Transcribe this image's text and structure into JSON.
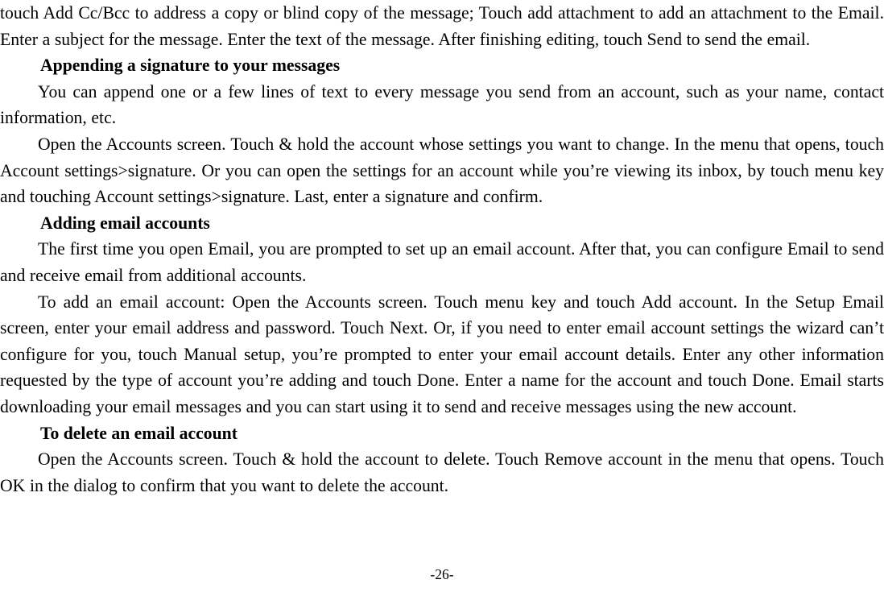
{
  "document": {
    "page_number_label": "-26-",
    "blocks": [
      {
        "type": "paragraph",
        "continued": true,
        "text": "touch Add Cc/Bcc to address a copy or blind copy of the message; Touch add attachment to add an attachment to the Email. Enter a subject for the message. Enter the text of the message. After finishing editing, touch Send to send the email."
      },
      {
        "type": "heading",
        "text": "Appending a signature to your messages"
      },
      {
        "type": "paragraph",
        "continued": false,
        "text": "You can append one or a few lines of text to every message you send from an account, such as your name, contact information, etc."
      },
      {
        "type": "paragraph",
        "continued": false,
        "text": "Open the Accounts screen. Touch & hold the account whose settings you want to change. In the menu that opens, touch Account settings>signature. Or you can open the settings for an account while you’re viewing its inbox, by touch menu key and touching Account settings>signature. Last, enter a signature and confirm."
      },
      {
        "type": "heading",
        "text": "Adding email accounts"
      },
      {
        "type": "paragraph",
        "continued": false,
        "text": "The first time you open Email, you are prompted to set up an email account. After that, you can configure Email to send and receive email from additional accounts."
      },
      {
        "type": "paragraph",
        "continued": false,
        "text": "To add an email account: Open the Accounts screen. Touch menu key and touch Add account. In the Setup Email screen, enter your email address and password. Touch Next. Or, if you need to enter email account settings the wizard can’t configure for you, touch Manual setup, you’re prompted to enter your email account details. Enter any other information requested by the type of account you’re adding and touch Done. Enter a name for the account and touch Done. Email starts downloading your email messages and you can start using it to send and receive messages using the new account."
      },
      {
        "type": "heading",
        "text": "To delete an email account"
      },
      {
        "type": "paragraph",
        "continued": false,
        "text": "Open the Accounts screen. Touch & hold the account to delete. Touch Remove account in the menu that opens. Touch OK in the dialog to confirm that you want to delete the account."
      }
    ]
  }
}
